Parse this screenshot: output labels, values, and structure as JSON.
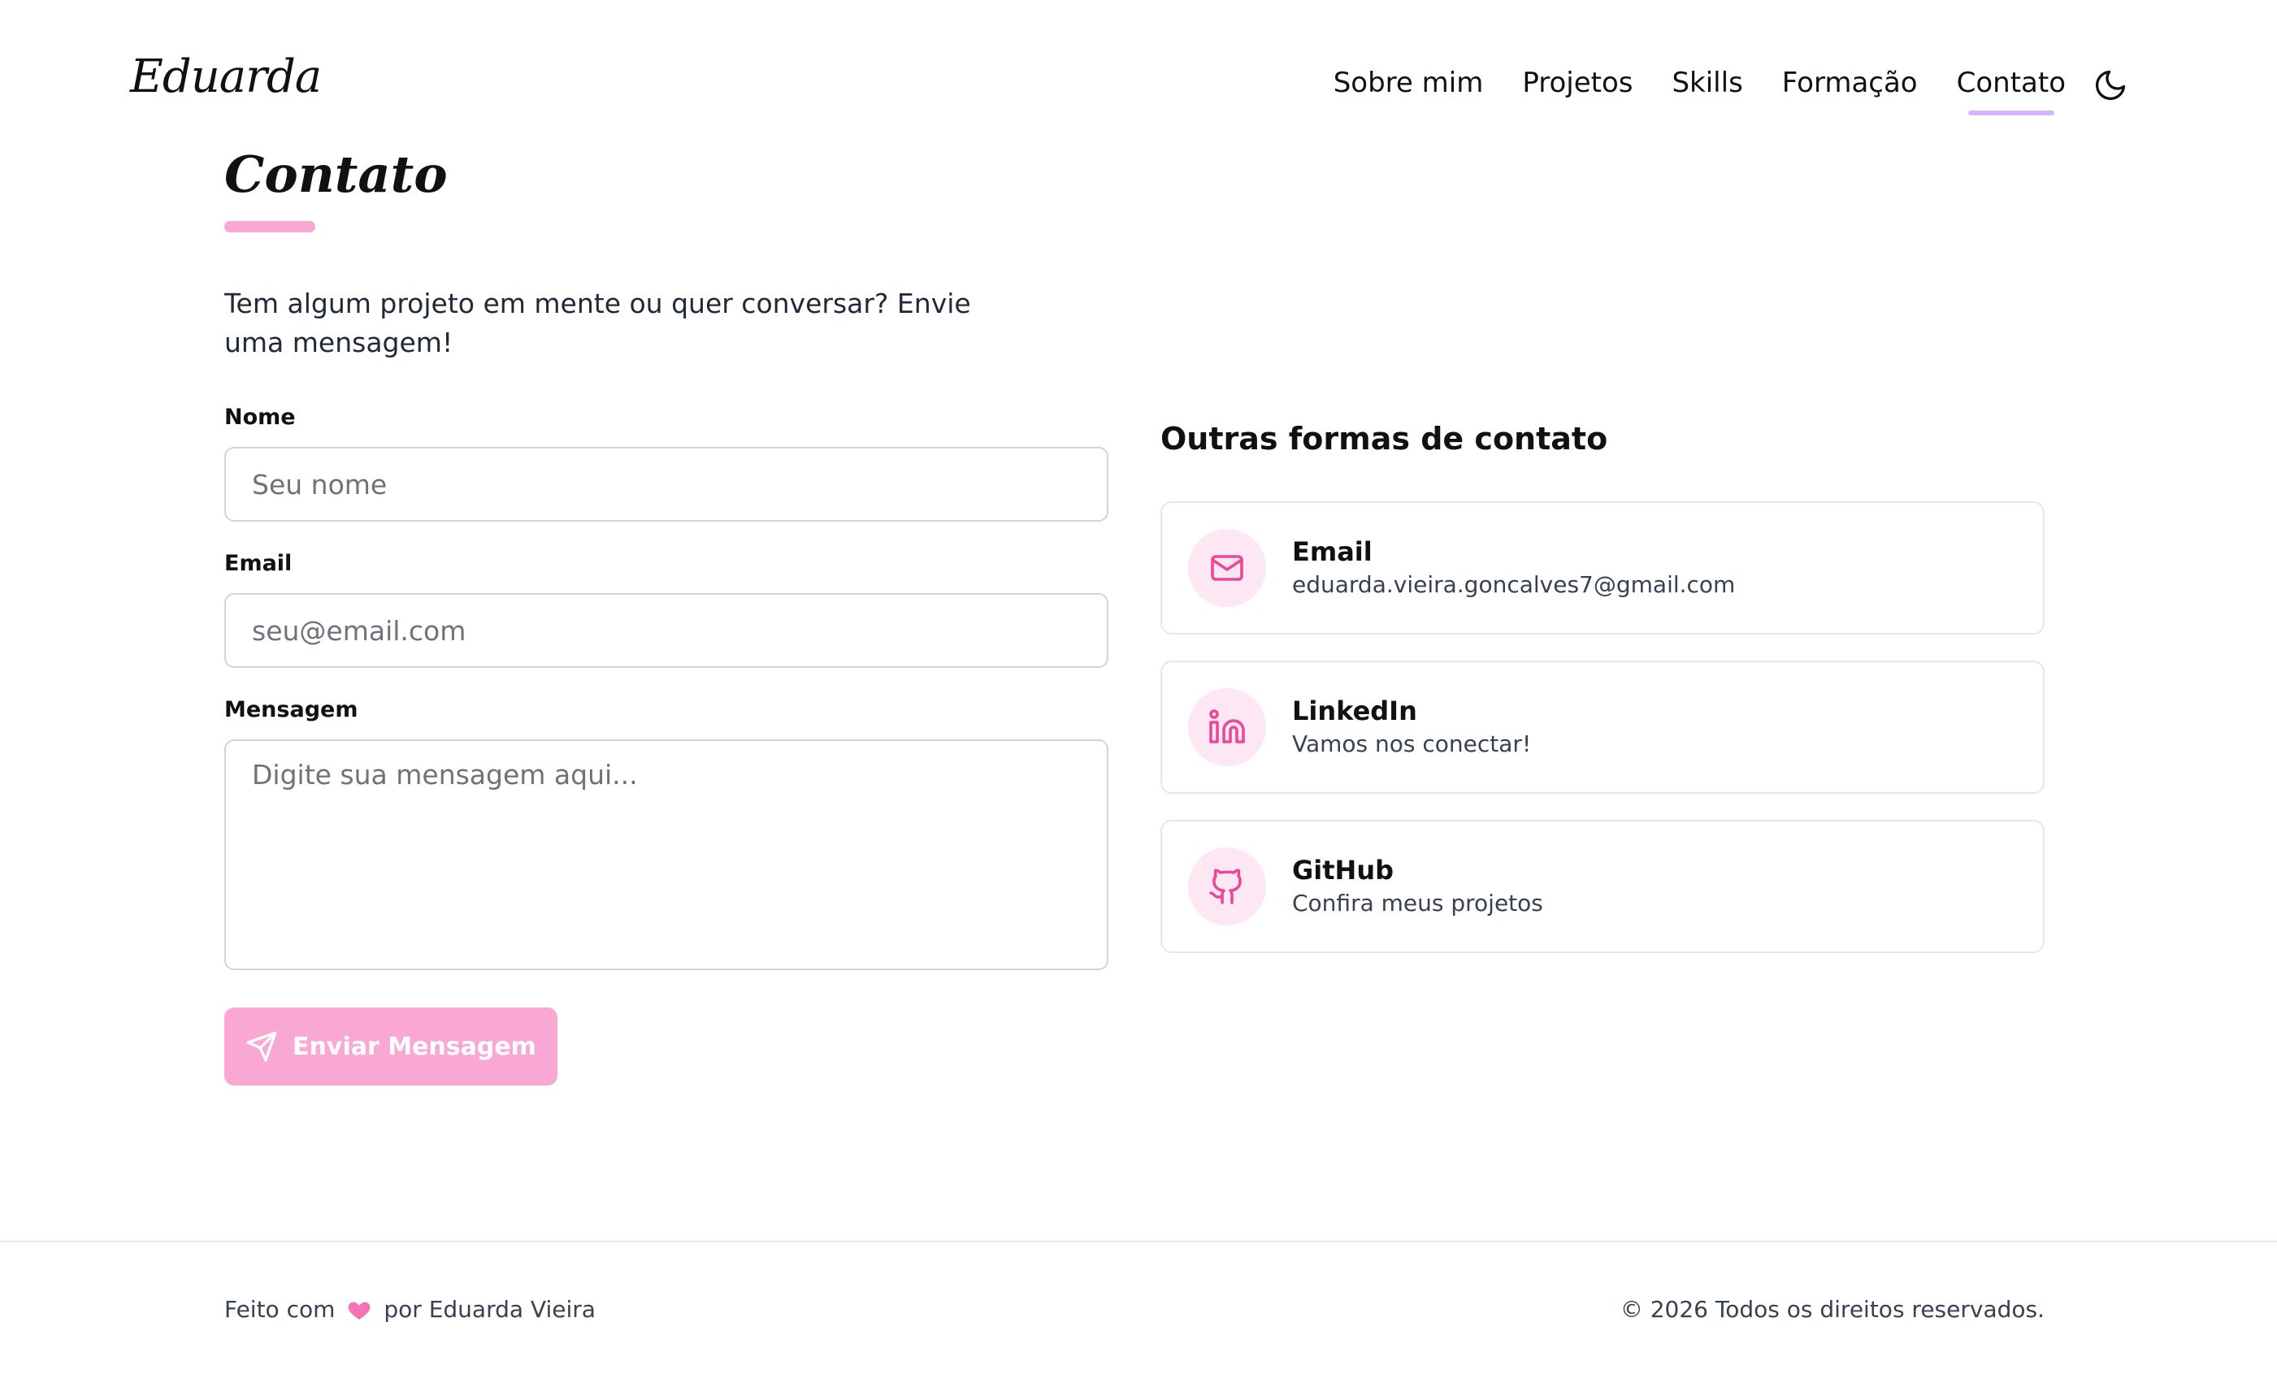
{
  "header": {
    "logo": "Eduarda",
    "nav": [
      {
        "label": "Sobre mim",
        "active": false
      },
      {
        "label": "Projetos",
        "active": false
      },
      {
        "label": "Skills",
        "active": false
      },
      {
        "label": "Formação",
        "active": false
      },
      {
        "label": "Contato",
        "active": true
      }
    ],
    "theme_toggle_icon": "moon-icon"
  },
  "page": {
    "title": "Contato",
    "intro": "Tem algum projeto em mente ou quer conversar? Envie uma mensagem!"
  },
  "form": {
    "name": {
      "label": "Nome",
      "placeholder": "Seu nome",
      "value": ""
    },
    "email": {
      "label": "Email",
      "placeholder": "seu@email.com",
      "value": ""
    },
    "message": {
      "label": "Mensagem",
      "placeholder": "Digite sua mensagem aqui...",
      "value": ""
    },
    "submit_label": "Enviar Mensagem",
    "submit_icon": "send-icon"
  },
  "contacts": {
    "title": "Outras formas de contato",
    "items": [
      {
        "title": "Email",
        "subtitle": "eduarda.vieira.goncalves7@gmail.com",
        "icon": "mail-icon"
      },
      {
        "title": "LinkedIn",
        "subtitle": "Vamos nos conectar!",
        "icon": "linkedin-icon"
      },
      {
        "title": "GitHub",
        "subtitle": "Confira meus projetos",
        "icon": "github-icon"
      }
    ]
  },
  "footer": {
    "made_with": "Feito com",
    "by": "por Eduarda Vieira",
    "copyright": "© 2026 Todos os direitos reservados."
  },
  "colors": {
    "accent_pink": "#f472b6",
    "button_pink": "#f9a8d4",
    "icon_bg": "#fce7f3",
    "nav_underline": "#d8b4fe"
  }
}
